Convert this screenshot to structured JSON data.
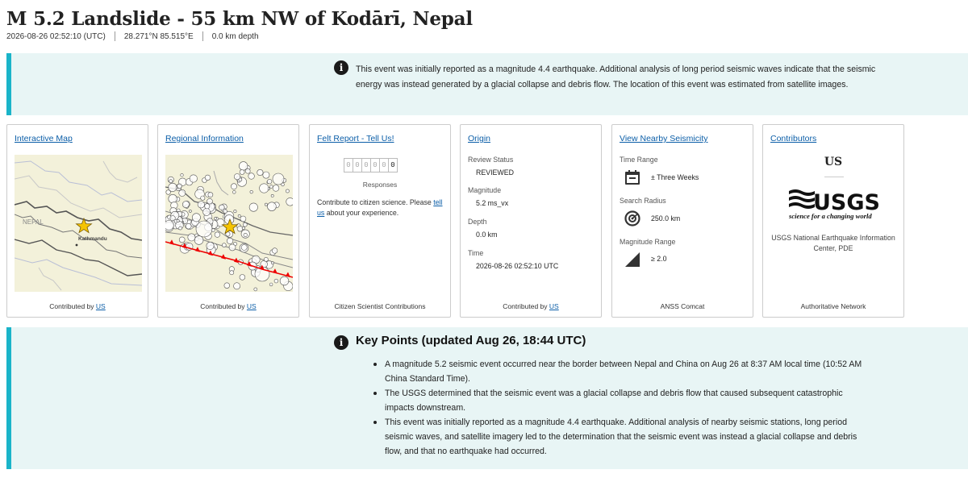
{
  "header": {
    "title": "M 5.2 Landslide - 55 km NW of Kodārī, Nepal",
    "time": "2026-08-26 02:52:10 (UTC)",
    "location": "28.271°N 85.515°E",
    "depth": "0.0 km depth"
  },
  "notice": {
    "text": "This event was initially reported as a magnitude 4.4 earthquake. Additional analysis of long period seismic waves indicate that the seismic energy was instead generated by a glacial collapse and debris flow. The location of this event was estimated from satellite images."
  },
  "cards": {
    "interactive_map": {
      "title": "Interactive Map",
      "map_label_country": "NEPAL",
      "map_label_city": "Kathmandu",
      "footer_prefix": "Contributed by",
      "footer_link": "US"
    },
    "regional": {
      "title": "Regional Information",
      "footer_prefix": "Contributed by",
      "footer_link": "US"
    },
    "felt": {
      "title": "Felt Report - Tell Us!",
      "digits": [
        "0",
        "0",
        "0",
        "0",
        "0",
        "0"
      ],
      "responses_label": "Responses",
      "text_before": "Contribute to citizen science. Please",
      "link": "tell us",
      "text_after": "about your experience.",
      "footer": "Citizen Scientist Contributions"
    },
    "origin": {
      "title": "Origin",
      "review_label": "Review Status",
      "review_value": "REVIEWED",
      "magnitude_label": "Magnitude",
      "magnitude_value": "5.2 ms_vx",
      "depth_label": "Depth",
      "depth_value": "0.0 km",
      "time_label": "Time",
      "time_value": "2026-08-26 02:52:10 UTC",
      "footer_prefix": "Contributed by",
      "footer_link": "US"
    },
    "nearby": {
      "title": "View Nearby Seismicity",
      "time_label": "Time Range",
      "time_value": "± Three Weeks",
      "radius_label": "Search Radius",
      "radius_value": "250.0 km",
      "mag_label": "Magnitude Range",
      "mag_value": "≥ 2.0",
      "footer": "ANSS Comcat"
    },
    "contributors": {
      "title": "Contributors",
      "code": "US",
      "logo_text": "USGS",
      "logo_tagline": "science for a changing world",
      "name": "USGS National Earthquake Information Center, PDE",
      "footer": "Authoritative Network"
    }
  },
  "key_points": {
    "title": "Key Points (updated Aug 26, 18:44 UTC)",
    "items": [
      "A magnitude 5.2 seismic event occurred near the border between Nepal and China on Aug 26 at 8:37 AM local time (10:52 AM China Standard Time).",
      "The USGS determined that the seismic event was a glacial collapse and debris flow that caused subsequent catastrophic impacts downstream.",
      "This event was initially reported as a magnitude 4.4 earthquake. Additional analysis of nearby seismic stations, long period seismic waves, and satellite imagery led to the determination that the seismic event was instead a glacial collapse and debris flow, and that no earthquake had occurred."
    ]
  },
  "colors": {
    "accent": "#1ab4c9",
    "alert_bg": "#e8f5f5",
    "link": "#0b5ea8",
    "epicenter_star": "#f5c400"
  }
}
